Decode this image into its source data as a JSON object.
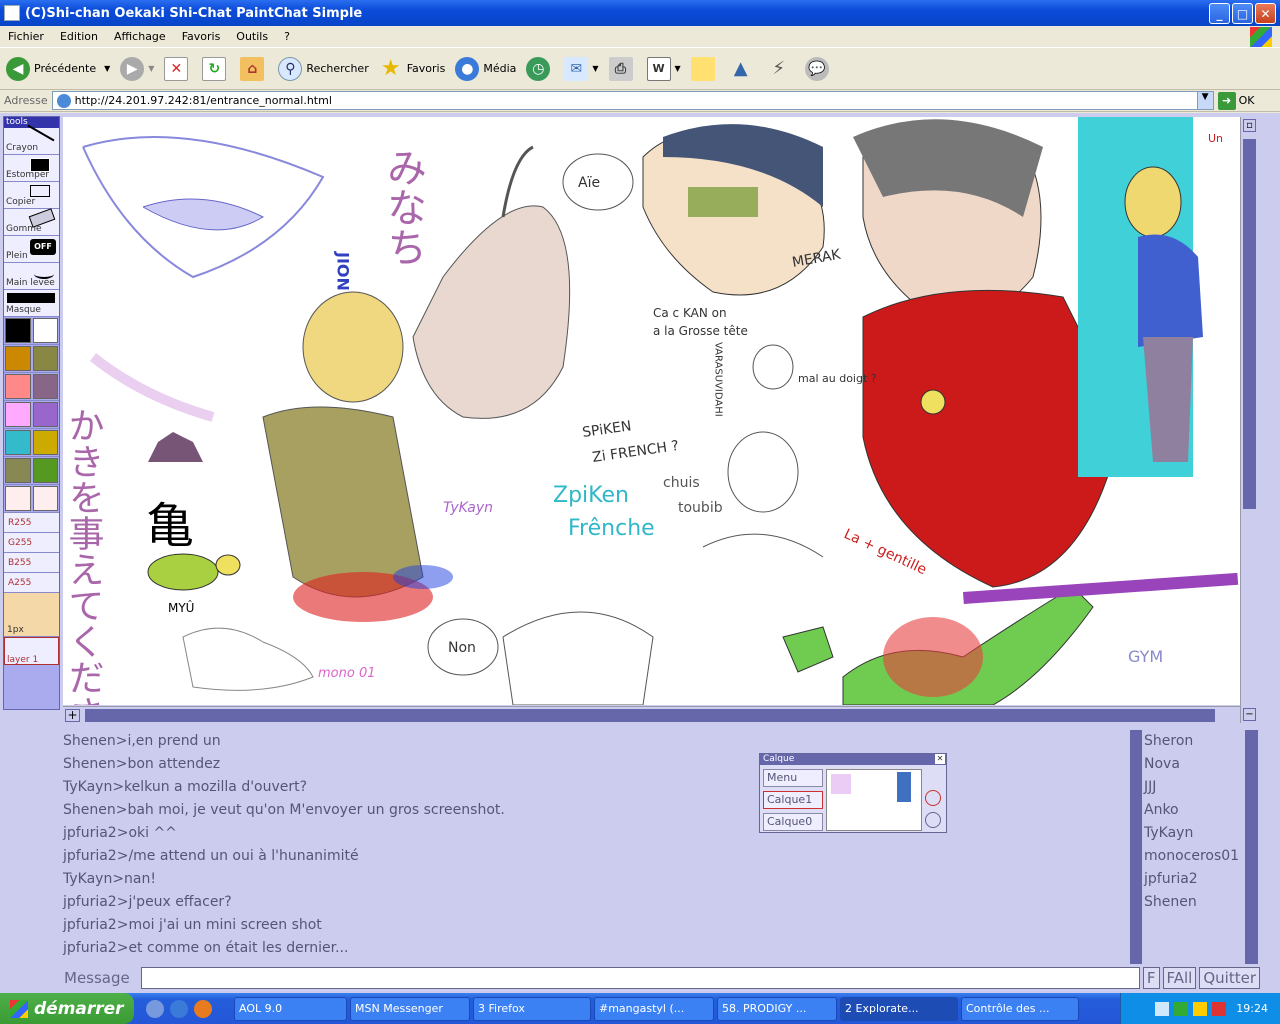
{
  "window": {
    "title": "(C)Shi-chan Oekaki Shi-Chat PaintChat Simple",
    "minimize_glyph": "_",
    "maximize_glyph": "□",
    "close_glyph": "✕"
  },
  "menu": [
    "Fichier",
    "Edition",
    "Affichage",
    "Favoris",
    "Outils",
    "?"
  ],
  "toolbar": {
    "back": "Précédente",
    "search": "Rechercher",
    "favorites": "Favoris",
    "media": "Média"
  },
  "address": {
    "label": "Adresse",
    "url": "http://24.201.97.242:81/entrance_normal.html",
    "go": "OK"
  },
  "tools": {
    "header": "tools",
    "items": [
      "Crayon",
      "Estomper",
      "Copier",
      "Gomme",
      "Plein",
      "Main levée",
      "Masque"
    ],
    "off_label": "OFF",
    "sliders": [
      "R255",
      "G255",
      "B255",
      "A255"
    ],
    "size": "1px",
    "layer": "layer 1"
  },
  "palette_colors": [
    [
      "#000000",
      "#ffffff"
    ],
    [
      "#cc8800",
      "#888844"
    ],
    [
      "#ff8888",
      "#886688"
    ],
    [
      "#ffaaff",
      "#9966cc"
    ],
    [
      "#33bbcc",
      "#ccaa00"
    ],
    [
      "#888855",
      "#559922"
    ],
    [
      "#ffeeee",
      "#ffeeee"
    ]
  ],
  "canvas_text": {
    "tykayn": "TyKayn",
    "myu": "MYÛ",
    "mono": "mono 01",
    "aie": "Aïe",
    "non": "Non",
    "merak": "MERAK",
    "cackan": "Ca c KAN on\na la Grosse tête",
    "spiken": "SPiKEN\nzi FRENCH ?",
    "zpiken": "ZpiKen\nFrênche",
    "chuis": "chuis\ntoubib",
    "maldoigt": "mal au\ndoigt ?",
    "gentille": "La + gentille",
    "gym": "GYM",
    "jion": "JION",
    "vara": "VARASUVIDAHI",
    "un": "Un"
  },
  "chat": [
    "Shenen>i,en prend un",
    "Shenen>bon attendez",
    "TyKayn>kelkun a mozilla d'ouvert?",
    "Shenen>bah moi, je veut qu'on M'envoyer un gros screenshot.",
    "jpfuria2>oki ^^",
    "jpfuria2>/me attend un oui à l'hunanimité",
    "TyKayn>nan!",
    "jpfuria2>j'peux effacer?",
    "jpfuria2>moi j'ai un mini screen shot",
    "jpfuria2>et comme on était les dernier..."
  ],
  "users": [
    "Sheron",
    "Nova",
    "JJJ",
    "Anko",
    "TyKayn",
    "monoceros01",
    "jpfuria2",
    "Shenen"
  ],
  "layer_window": {
    "title": "Calque",
    "menu": "Menu",
    "layers": [
      "Calque1",
      "Calque0"
    ]
  },
  "message": {
    "label": "Message",
    "btn_f": "F",
    "btn_fall": "FAll",
    "btn_quit": "Quitter"
  },
  "taskbar": {
    "start": "démarrer",
    "tasks": [
      "AOL 9.0",
      "MSN Messenger",
      "3 Firefox",
      "#mangastyl (...",
      "58. PRODIGY ...",
      "2 Explorate...",
      "Contrôle des ..."
    ],
    "clock": "19:24"
  }
}
